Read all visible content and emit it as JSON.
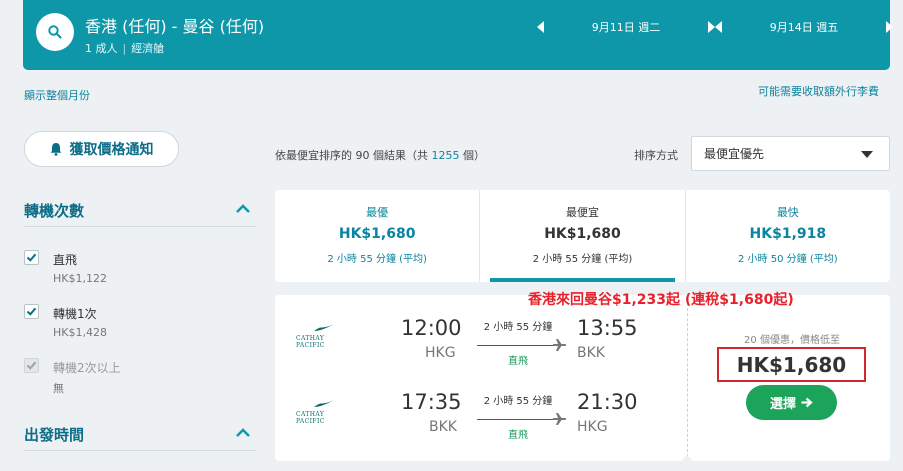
{
  "search": {
    "route": "香港 (任何) - 曼谷 (任何)",
    "passengers": "1 成人",
    "cabin": "經濟艙",
    "depart_date": "9月11日 週二",
    "return_date": "9月14日 週五"
  },
  "links": {
    "whole_month": "顯示整個月份",
    "extra_fees": "可能需要收取額外行李費"
  },
  "filters": {
    "price_alert": "獲取價格通知",
    "stops_title": "轉機次數",
    "options": [
      {
        "label": "直飛",
        "price": "HK$1,122",
        "checked": true
      },
      {
        "label": "轉機1次",
        "price": "HK$1,428",
        "checked": true
      },
      {
        "label": "轉機2次以上",
        "price": "無",
        "checked": true,
        "disabled": true
      }
    ],
    "depart_time_title": "出發時間"
  },
  "results": {
    "prefix": "依最便宜排序的",
    "count": "90",
    "middle": "個結果（共",
    "total": "1255",
    "suffix": "個）"
  },
  "sort": {
    "label": "排序方式",
    "selected": "最便宜優先"
  },
  "tabs": [
    {
      "label": "最優",
      "price": "HK$1,680",
      "duration": "2 小時 55 分鐘 (平均)",
      "active": false
    },
    {
      "label": "最便宜",
      "price": "HK$1,680",
      "duration": "2 小時 55 分鐘 (平均)",
      "active": true
    },
    {
      "label": "最快",
      "price": "HK$1,918",
      "duration": "2 小時 50 分鐘 (平均)",
      "active": false
    }
  ],
  "promo": "香港來回曼谷$1,233起 (連稅$1,680起)",
  "card": {
    "airline": "CATHAY PACIFIC",
    "outbound": {
      "dep_time": "12:00",
      "dep_airport": "HKG",
      "duration": "2 小時 55 分鐘",
      "stops": "直飛",
      "arr_time": "13:55",
      "arr_airport": "BKK"
    },
    "inbound": {
      "dep_time": "17:35",
      "dep_airport": "BKK",
      "duration": "2 小時 55 分鐘",
      "stops": "直飛",
      "arr_time": "21:30",
      "arr_airport": "HKG"
    },
    "deals": "20 個優惠，價格低至",
    "price": "HK$1,680",
    "select_label": "選擇"
  },
  "colors": {
    "brand": "#0e97a9",
    "select": "#1ca45a",
    "promo": "#e8222c"
  }
}
